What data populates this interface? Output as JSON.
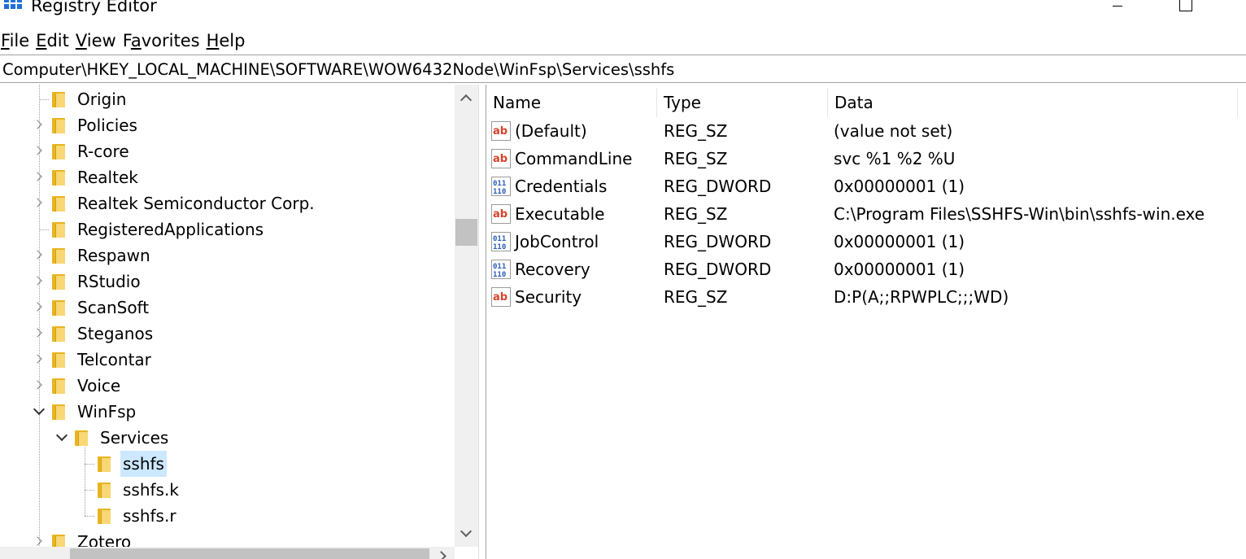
{
  "window": {
    "title": "Registry Editor"
  },
  "menu": [
    {
      "accel": "F",
      "rest": "ile"
    },
    {
      "accel": "E",
      "rest": "dit"
    },
    {
      "accel": "V",
      "rest": "iew"
    },
    {
      "accel": "",
      "pre": "F",
      "accel2": "a",
      "rest": "vorites"
    },
    {
      "accel": "H",
      "rest": "elp"
    }
  ],
  "address": "Computer\\HKEY_LOCAL_MACHINE\\SOFTWARE\\WOW6432Node\\WinFsp\\Services\\sshfs",
  "tree": {
    "items": [
      {
        "label": "Origin",
        "expander": "none"
      },
      {
        "label": "Policies",
        "expander": "collapsed"
      },
      {
        "label": "R-core",
        "expander": "collapsed"
      },
      {
        "label": "Realtek",
        "expander": "collapsed"
      },
      {
        "label": "Realtek Semiconductor Corp.",
        "expander": "collapsed"
      },
      {
        "label": "RegisteredApplications",
        "expander": "none"
      },
      {
        "label": "Respawn",
        "expander": "collapsed"
      },
      {
        "label": "RStudio",
        "expander": "collapsed"
      },
      {
        "label": "ScanSoft",
        "expander": "collapsed"
      },
      {
        "label": "Steganos",
        "expander": "collapsed"
      },
      {
        "label": "Telcontar",
        "expander": "collapsed"
      },
      {
        "label": "Voice",
        "expander": "collapsed"
      },
      {
        "label": "WinFsp",
        "expander": "expanded"
      },
      {
        "label": "Services",
        "expander": "expanded"
      },
      {
        "label": "sshfs",
        "expander": "none",
        "selected": true
      },
      {
        "label": "sshfs.k",
        "expander": "none"
      },
      {
        "label": "sshfs.r",
        "expander": "none"
      },
      {
        "label": "Zotero",
        "expander": "collapsed"
      }
    ]
  },
  "list": {
    "columns": [
      "Name",
      "Type",
      "Data"
    ],
    "rows": [
      {
        "name": "(Default)",
        "type": "REG_SZ",
        "data": "(value not set)",
        "icon": "string-value-icon"
      },
      {
        "name": "CommandLine",
        "type": "REG_SZ",
        "data": "svc %1 %2 %U",
        "icon": "string-value-icon"
      },
      {
        "name": "Credentials",
        "type": "REG_DWORD",
        "data": "0x00000001 (1)",
        "icon": "binary-value-icon"
      },
      {
        "name": "Executable",
        "type": "REG_SZ",
        "data": "C:\\Program Files\\SSHFS-Win\\bin\\sshfs-win.exe",
        "icon": "string-value-icon"
      },
      {
        "name": "JobControl",
        "type": "REG_DWORD",
        "data": "0x00000001 (1)",
        "icon": "binary-value-icon"
      },
      {
        "name": "Recovery",
        "type": "REG_DWORD",
        "data": "0x00000001 (1)",
        "icon": "binary-value-icon"
      },
      {
        "name": "Security",
        "type": "REG_SZ",
        "data": "D:P(A;;RPWPLC;;;WD)",
        "icon": "string-value-icon"
      }
    ]
  },
  "colors": {
    "selection": "#cce8ff",
    "folder": "#f8d774",
    "string_icon": "#d9432b",
    "binary_icon": "#2a5bb8"
  }
}
